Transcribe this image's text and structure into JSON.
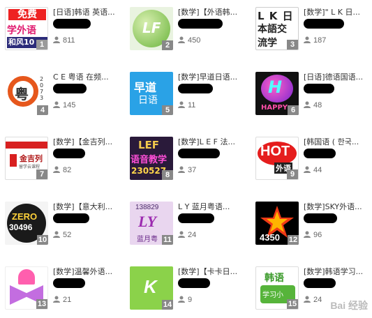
{
  "items": [
    {
      "title": "[日语]韩语 英语...",
      "count": "811",
      "rank": "1",
      "logo_lines": [
        "免费",
        "学外语",
        "和风10"
      ]
    },
    {
      "title": "[数学]【外语韩...",
      "count": "450",
      "rank": "2",
      "logo_lines": [
        "LF"
      ]
    },
    {
      "title": "[数学]\" L K 日...",
      "count": "187",
      "rank": "3",
      "logo_lines": [
        "L K 日",
        "本語交",
        "流学"
      ]
    },
    {
      "title": "C E 粤语 在频...",
      "count": "145",
      "rank": "4",
      "logo_lines": [
        "粤",
        "2073"
      ]
    },
    {
      "title": "[数学]早道日语...",
      "count": "11",
      "rank": "5",
      "logo_lines": [
        "早道",
        "日语"
      ]
    },
    {
      "title": "[日语]德语国语...",
      "count": "48",
      "rank": "6",
      "logo_lines": [
        "HAPPY"
      ]
    },
    {
      "title": "[数学]【金吉列...",
      "count": "82",
      "rank": "7",
      "logo_lines": [
        "金吉列",
        "留学云课程"
      ]
    },
    {
      "title": "[数学]L E F 法...",
      "count": "37",
      "rank": "8",
      "logo_lines": [
        "LEF",
        "语音教学",
        "230527"
      ]
    },
    {
      "title": "[韩国语 ( 한국...",
      "count": "44",
      "rank": "9",
      "logo_lines": [
        "HOT",
        "外语"
      ]
    },
    {
      "title": "[数学]【意大利...",
      "count": "52",
      "rank": "10",
      "logo_lines": [
        "ZERO",
        "30496"
      ]
    },
    {
      "title": "L Y 蓝月粤语...",
      "count": "24",
      "rank": "11",
      "logo_lines": [
        "138829",
        "LY",
        "蓝月粤"
      ]
    },
    {
      "title": "[数学]SKY外语...",
      "count": "96",
      "rank": "12",
      "logo_lines": [
        "4350"
      ]
    },
    {
      "title": "[数学]温馨外语...",
      "count": "21",
      "rank": "13",
      "logo_lines": []
    },
    {
      "title": "[数学]【卡卡日...",
      "count": "9",
      "rank": "14",
      "logo_lines": [
        "K"
      ]
    },
    {
      "title": "[数学]韩语学习...",
      "count": "24",
      "rank": "15",
      "logo_lines": [
        "韩语",
        "学习小"
      ]
    }
  ],
  "watermark": "Bai 经验"
}
